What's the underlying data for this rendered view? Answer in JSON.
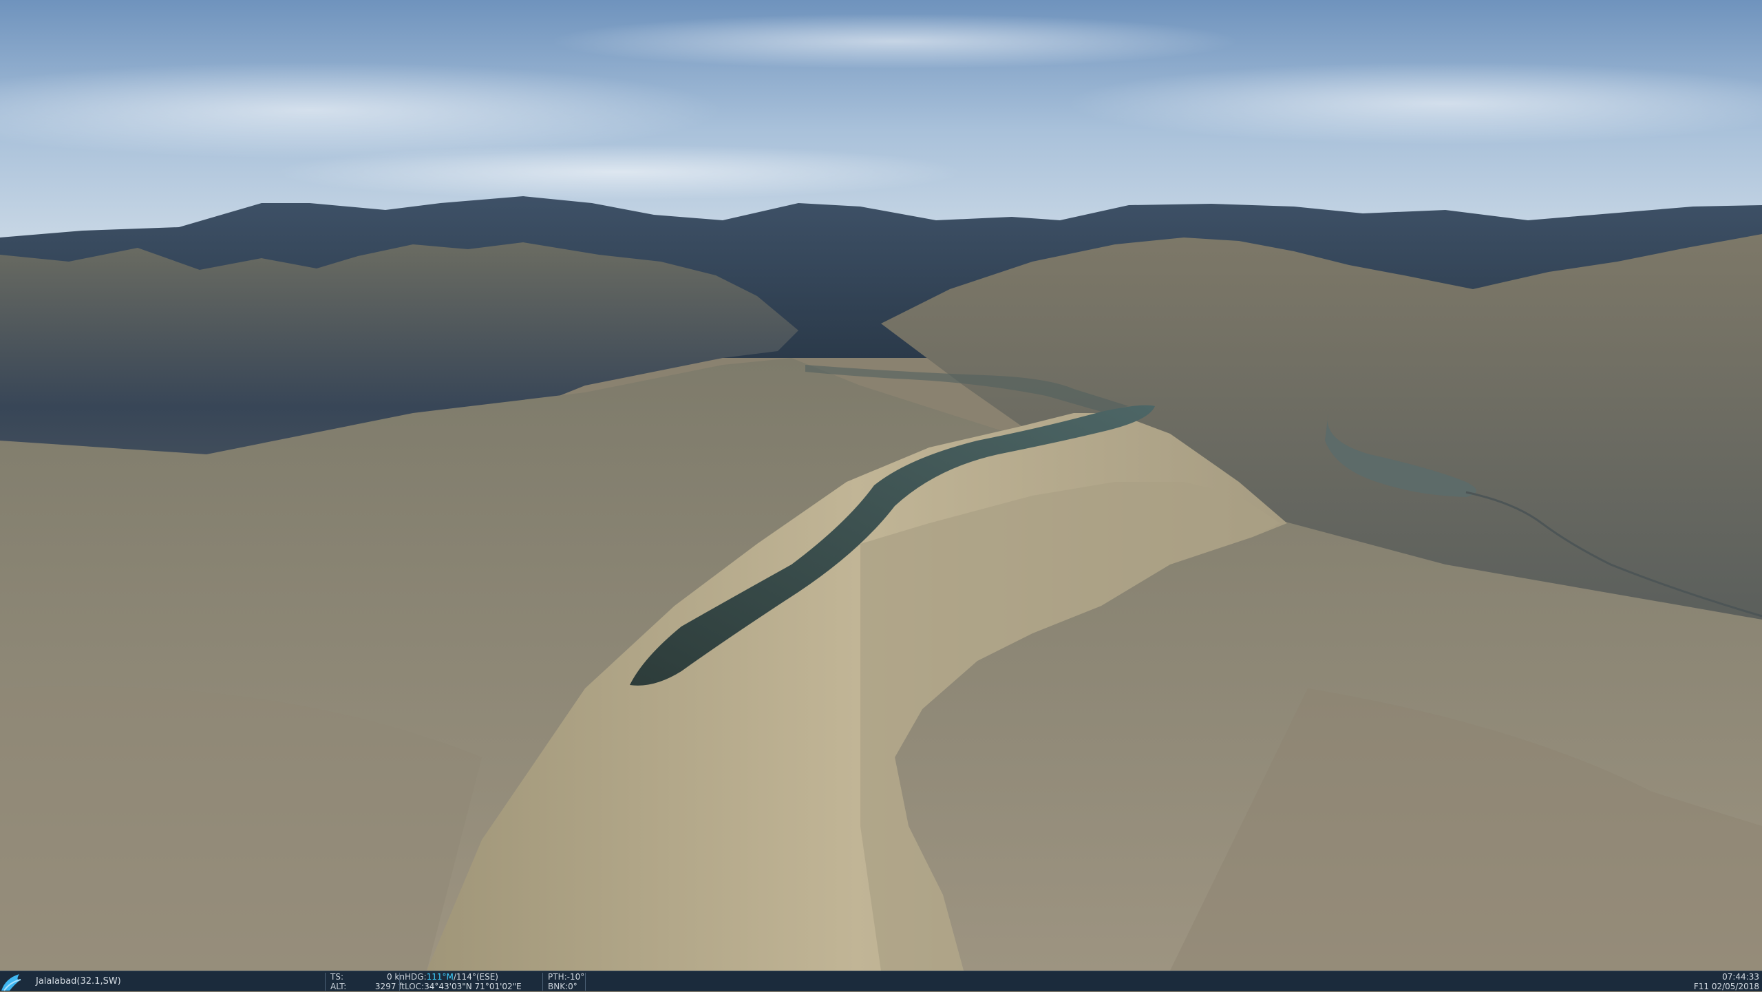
{
  "scene": {
    "description_icon": "terrain-3d-view"
  },
  "statusbar": {
    "logo_icon": "wing-logo-icon",
    "map": "Jalalabad(32.1,SW)",
    "ts_label": "TS:",
    "ts_value": "0 kn",
    "alt_label": "ALT:",
    "alt_value": "3297 ft",
    "hdg_label": "HDG:",
    "hdg_mag": "111°M",
    "hdg_true": "/114°(ESE)",
    "loc_label": "LOC:",
    "loc_value": "34°43'03\"N 71°01'02\"E",
    "pth_label": "PTH:",
    "pth_value": "-10°",
    "bnk_label": "BNK:",
    "bnk_value": "0°",
    "time": "07:44:33",
    "date": "F11 02/05/2018"
  },
  "colors": {
    "statusbar_bg": "#1b2b3c",
    "accent": "#40d0ff"
  }
}
